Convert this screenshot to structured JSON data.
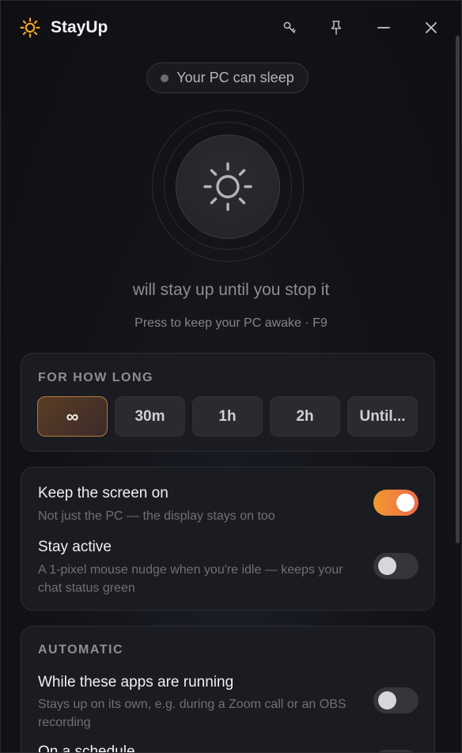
{
  "app": {
    "title": "StayUp"
  },
  "titlebar": {
    "icons": [
      "key-icon",
      "pin-icon",
      "minimize-icon",
      "close-icon"
    ]
  },
  "status": {
    "text": "Your PC can sleep"
  },
  "main": {
    "caption": "will stay up until you stop it",
    "hint": "Press to keep your PC awake · F9"
  },
  "duration": {
    "label": "FOR HOW LONG",
    "options": [
      "∞",
      "30m",
      "1h",
      "2h",
      "Until..."
    ],
    "selected": "∞"
  },
  "options": {
    "screen": {
      "title": "Keep the screen on",
      "desc": "Not just the PC — the display stays on too",
      "on": true
    },
    "active": {
      "title": "Stay active",
      "desc": "A 1-pixel mouse nudge when you're idle — keeps your chat status green",
      "on": false
    }
  },
  "automatic": {
    "label": "AUTOMATIC",
    "apps": {
      "title": "While these apps are running",
      "desc": "Stays up on its own, e.g. during a Zoom call or an OBS recording",
      "on": false
    },
    "schedule": {
      "title": "On a schedule",
      "on": false
    }
  },
  "colors": {
    "accent_orange": "#f09a2f",
    "accent_coral": "#ee6a4a",
    "sun_icon": "#f5a623"
  }
}
